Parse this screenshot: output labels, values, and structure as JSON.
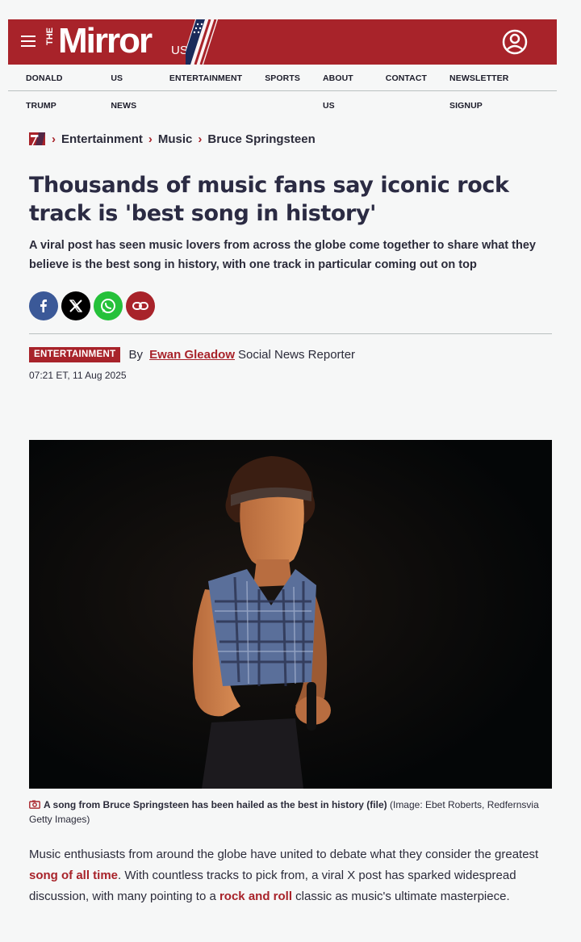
{
  "masthead": {
    "logo_the": "THE",
    "logo_main": "Mirror",
    "logo_suffix": "US"
  },
  "nav": {
    "items": [
      "DONALD TRUMP",
      "US NEWS",
      "ENTERTAINMENT",
      "SPORTS",
      "ABOUT US",
      "CONTACT",
      "NEWSLETTER SIGNUP"
    ]
  },
  "breadcrumb": {
    "items": [
      "Entertainment",
      "Music",
      "Bruce Springsteen"
    ]
  },
  "article": {
    "headline": "Thousands of music fans say iconic rock track is 'best song in history'",
    "standfirst": "A viral post has seen music lovers from across the globe come together to share what they believe is the best song in history, with one track in particular coming out on top",
    "category": "ENTERTAINMENT",
    "by_prefix": "By",
    "author": "Ewan Gleadow",
    "author_role": "Social News Reporter",
    "timestamp": "07:21 ET, 11 Aug 2025",
    "caption_main": "A song from Bruce Springsteen has been hailed as the best in history (file)",
    "caption_credit": "(Image: Ebet Roberts, Redfernsvia Getty Images)",
    "body": {
      "p1_a": "Music enthusiasts from around the globe have united to debate what they consider the greatest ",
      "link1": "song of all time",
      "p1_b": ". With countless tracks to pick from, a viral X post has sparked widespread discussion, with many pointing to a ",
      "link2": "rock and roll",
      "p1_c": " classic as music's ultimate masterpiece."
    }
  },
  "share": {
    "buttons": [
      {
        "icon": "facebook-icon",
        "color": "#3b5998"
      },
      {
        "icon": "x-icon",
        "color": "#000000"
      },
      {
        "icon": "whatsapp-icon",
        "color": "#25c13a"
      },
      {
        "icon": "link-icon",
        "color": "#a8232a"
      }
    ]
  },
  "colors": {
    "brand": "#a8232a",
    "text": "#2b2b3a",
    "background": "#f6f7f7"
  }
}
